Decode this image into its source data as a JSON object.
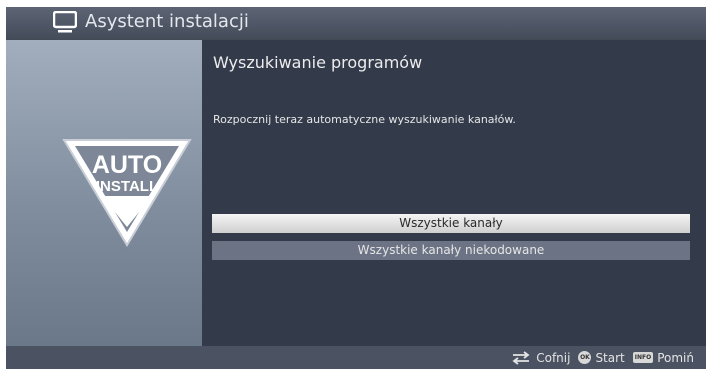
{
  "header": {
    "title": "Asystent instalacji",
    "icon": "tv-icon"
  },
  "sidebar": {
    "badge": {
      "line1": "AUTO",
      "line2": "INSTALL",
      "icon": "auto-install-icon"
    }
  },
  "main": {
    "title": "Wyszukiwanie programów",
    "message": "Rozpocznij teraz automatyczne wyszukiwanie kanałów.",
    "options": [
      {
        "label": "Wszystkie kanały",
        "selected": true
      },
      {
        "label": "Wszystkie kanały niekodowane",
        "selected": false
      }
    ]
  },
  "footer": {
    "hints": [
      {
        "icon": "back-arrows-icon",
        "label": "Cofnij"
      },
      {
        "key": "OK",
        "label": "Start"
      },
      {
        "key": "INFO",
        "label": "Pomiń"
      }
    ]
  },
  "colors": {
    "titlebar": "#4b5262",
    "content_bg": "#333a4a",
    "selected_option": "#e6e6e6",
    "unselected_option": "#6b7384"
  }
}
